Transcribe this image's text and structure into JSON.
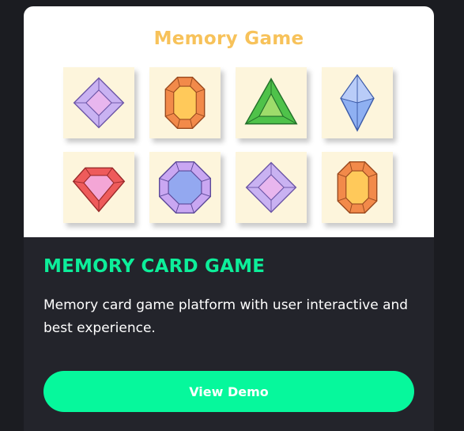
{
  "preview": {
    "title": "Memory Game",
    "tiles": [
      {
        "icon": "purple-diamond-gem-icon"
      },
      {
        "icon": "orange-emerald-gem-icon"
      },
      {
        "icon": "green-triangle-gem-icon"
      },
      {
        "icon": "blue-crystal-gem-icon"
      },
      {
        "icon": "red-heart-gem-icon"
      },
      {
        "icon": "purple-octagon-gem-icon"
      },
      {
        "icon": "purple-diamond-gem-icon"
      },
      {
        "icon": "orange-emerald-gem-icon"
      }
    ]
  },
  "card": {
    "title": "MEMORY CARD GAME",
    "description": "Memory card game platform with user interactive and best experience.",
    "button_label": "View Demo"
  },
  "colors": {
    "page_background": "#1b1c21",
    "card_background": "#23242b",
    "accent": "#06f89c",
    "heading": "#0dee9a",
    "game_title": "#f7c25a",
    "tile_background": "#fdf5dc"
  }
}
